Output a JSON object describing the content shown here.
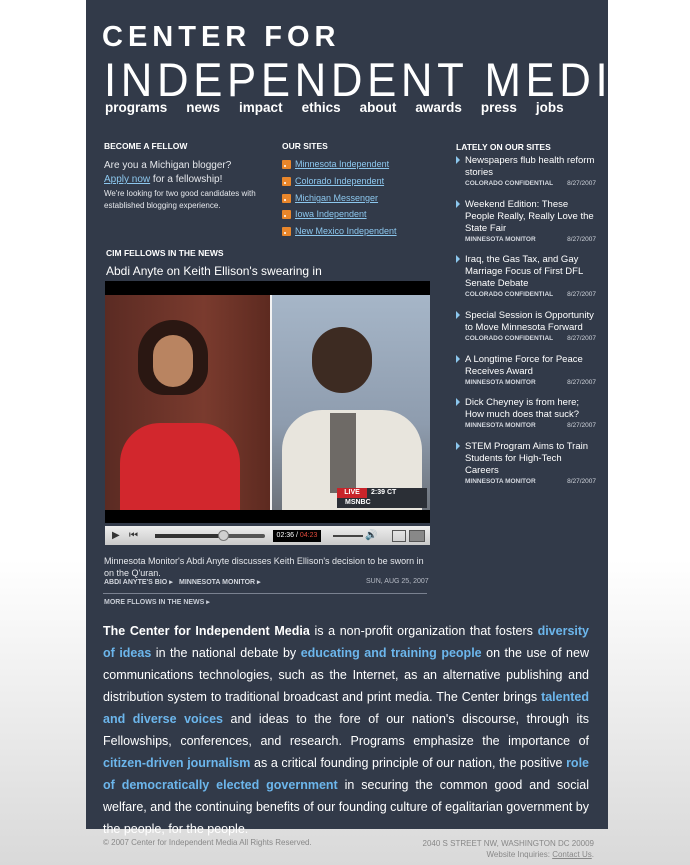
{
  "header": {
    "logo_line1": "CENTER FOR",
    "logo_line2": "INDEPENDENT MEDIA"
  },
  "nav": [
    "programs",
    "news",
    "impact",
    "ethics",
    "about",
    "awards",
    "press",
    "jobs"
  ],
  "fellow": {
    "heading": "BECOME A FELLOW",
    "line1": "Are you a Michigan blogger?",
    "apply_link": "Apply now",
    "apply_suffix": " for a fellowship!",
    "small": "We're looking for two good  candidates with established blogging experience."
  },
  "our_sites": {
    "heading": "OUR SITES",
    "items": [
      "Minnesota Independent",
      "Colorado Independent",
      "Michigan Messenger",
      "Iowa Independent",
      "New Mexico Independent"
    ]
  },
  "fellows_news": {
    "heading": "CIM FELLOWS IN THE NEWS",
    "title": "Abdi Anyte on Keith Ellison's swearing in",
    "caption": "Minnesota Monitor's Abdi Anyte discusses Keith Ellison's decision to be sworn in on the Q'uran.",
    "bio_link": "ABDI ANYTE'S BIO",
    "site_link": "MINNESOTA MONITOR",
    "date": "SUN, AUG 25, 2007",
    "more": "MORE FLLOWS IN THE NEWS",
    "video": {
      "overlay_live": "LIVE",
      "overlay_time": "2:39",
      "overlay_zone": "CT",
      "overlay_brand": "MSNBC",
      "time_elapsed": "02:36",
      "time_total": "04:23"
    }
  },
  "lately": {
    "heading": "LATELY ON OUR SITES",
    "items": [
      {
        "title": "Newspapers flub health reform stories",
        "source": "COLORADO CONFIDENTIAL",
        "date": "8/27/2007"
      },
      {
        "title": "Weekend Edition: These People Really, Really Love the State Fair",
        "source": "MINNESOTA MONITOR",
        "date": "8/27/2007"
      },
      {
        "title": "Iraq, the Gas Tax, and Gay Marriage Focus of First DFL Senate Debate",
        "source": "COLORADO CONFIDENTIAL",
        "date": "8/27/2007"
      },
      {
        "title": "Special Session is Opportunity to Move Minnesota Forward",
        "source": "COLORADO CONFIDENTIAL",
        "date": "8/27/2007"
      },
      {
        "title": "A Longtime Force for Peace Receives Award",
        "source": "MINNESOTA MONITOR",
        "date": "8/27/2007"
      },
      {
        "title": "Dick Cheyney is from here; How much does that suck?",
        "source": "MINNESOTA MONITOR",
        "date": "8/27/2007"
      },
      {
        "title": "STEM Program Aims to Train Students  for High-Tech Careers",
        "source": "MINNESOTA MONITOR",
        "date": "8/27/2007"
      }
    ]
  },
  "about": {
    "org": "The Center for Independent Media",
    "t1": " is a non-profit organization that fosters ",
    "h1": "diversity of ideas",
    "t2": " in the national debate by ",
    "h2": "educating and training people",
    "t3": " on the use of new communications technologies, such as the Internet, as an alternative publishing and distribution system to traditional broadcast and print media. The Center brings ",
    "h3": "talented and diverse voices",
    "t4": " and ideas to the fore of our nation's discourse, through its Fellowships, conferences, and research. Programs emphasize the importance of ",
    "h4": "citizen-driven journalism",
    "t5": " as a critical founding principle of our nation, the positive ",
    "h5": "role of democratically elected government",
    "t6": " in securing the common good and social welfare, and the continuing benefits of our founding culture of egalitarian government by the people, for the people."
  },
  "footer": {
    "copyright": "© 2007 Center for Independent Media All Rights Reserved.",
    "address": "2040 S STREET NW, WASHINGTON DC 20009",
    "inquiries": "Website Inquiries: ",
    "contact": "Contact Us",
    "contact_suffix": "."
  },
  "colors": {
    "panel": "#323a49",
    "accent": "#6cb6ec",
    "link": "#8cc7ee"
  }
}
